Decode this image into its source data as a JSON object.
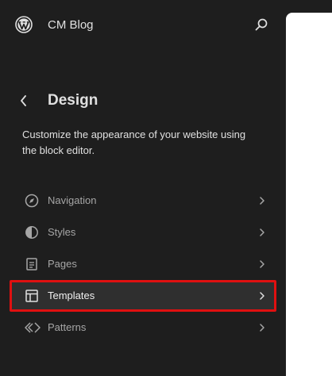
{
  "topbar": {
    "site_title": "CM Blog",
    "logo_icon": "wordpress-icon",
    "search_icon": "search-icon"
  },
  "header": {
    "title": "Design",
    "back_icon": "chevron-left-icon"
  },
  "description": "Customize the appearance of your website using the block editor.",
  "nav": {
    "items": [
      {
        "label": "Navigation",
        "icon": "navigation-icon",
        "active": false
      },
      {
        "label": "Styles",
        "icon": "styles-icon",
        "active": false
      },
      {
        "label": "Pages",
        "icon": "page-icon",
        "active": false
      },
      {
        "label": "Templates",
        "icon": "layout-icon",
        "active": true
      },
      {
        "label": "Patterns",
        "icon": "symbol-icon",
        "active": false
      }
    ]
  },
  "colors": {
    "background": "#1e1e1e",
    "text": "#e0e0e0",
    "muted_text": "#a6a6a6",
    "highlight_border": "#e01010",
    "active_bg": "#2f2f2f",
    "canvas": "#ffffff"
  }
}
